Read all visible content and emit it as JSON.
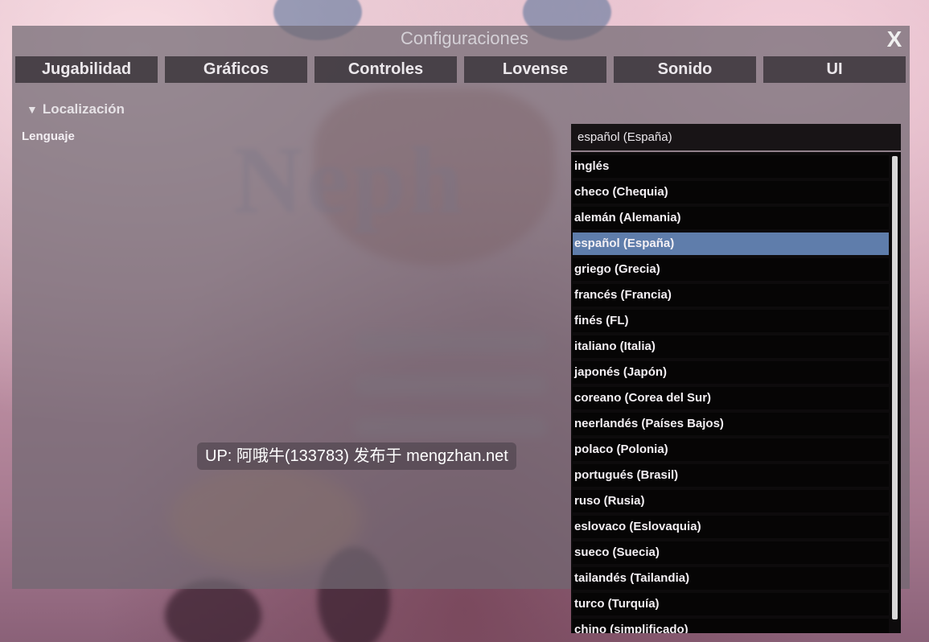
{
  "window": {
    "title": "Configuraciones",
    "close_label": "X"
  },
  "tabs": [
    {
      "label": "Jugabilidad"
    },
    {
      "label": "Gráficos"
    },
    {
      "label": "Controles"
    },
    {
      "label": "Lovense"
    },
    {
      "label": "Sonido"
    },
    {
      "label": "UI"
    }
  ],
  "section": {
    "arrow": "▼",
    "title": "Localización"
  },
  "language": {
    "label": "Lenguaje",
    "selected": "español (España)",
    "options": [
      "inglés",
      "checo (Chequia)",
      "alemán (Alemania)",
      "español (España)",
      "griego (Grecia)",
      "francés (Francia)",
      "finés (FL)",
      "italiano (Italia)",
      "japonés (Japón)",
      "coreano (Corea del Sur)",
      "neerlandés (Países Bajos)",
      "polaco (Polonia)",
      "portugués (Brasil)",
      "ruso (Rusia)",
      "eslovaco (Eslovaquia)",
      "sueco (Suecia)",
      "tailandés (Tailandia)",
      "turco (Turquía)",
      "chino (simplificado)"
    ],
    "highlighted_index": 3
  },
  "watermark": "UP: 阿哦牛(133783) 发布于 mengzhan.net",
  "colors": {
    "panel": "#706872",
    "tab_bg": "#423c42",
    "dropdown_bg": "#060505",
    "selected_option": "#5f7dab"
  }
}
